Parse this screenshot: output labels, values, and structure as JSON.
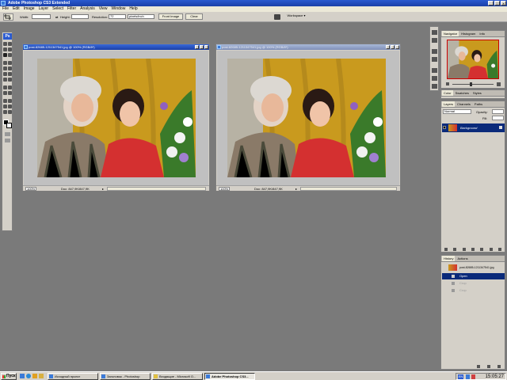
{
  "window": {
    "title": "Adobe Photoshop CS3 Extended"
  },
  "menu": [
    "File",
    "Edit",
    "Image",
    "Layer",
    "Select",
    "Filter",
    "Analysis",
    "View",
    "Window",
    "Help"
  ],
  "options_bar": {
    "width_label": "Width:",
    "height_label": "Height:",
    "resolution_label": "Resolution:",
    "resolution_value": "72",
    "resolution_unit": "pixels/inch",
    "front_image_label": "Front Image",
    "clear_label": "Clear",
    "workspace_label": "Workspace"
  },
  "toolbox": {
    "logo": "Ps"
  },
  "documents": [
    {
      "title": "post-82685-1211347541.jpg @ 100% (RGB/8*)",
      "zoom": "100%",
      "doc_info": "Doc: 847,9K/847,9K",
      "active": true
    },
    {
      "title": "post-82685-1211347541.jpg @ 100% (RGB/8*)",
      "zoom": "100%",
      "doc_info": "Doc: 847,9K/847,9K",
      "active": false
    }
  ],
  "panels": {
    "navigator_tabs": [
      "Navigator",
      "Histogram",
      "Info"
    ],
    "color_tabs": [
      "Color",
      "Swatches",
      "Styles"
    ],
    "layers_tabs": [
      "Layers",
      "Channels",
      "Paths"
    ],
    "layers_mode": "Normal",
    "layers_opacity_label": "Opacity:",
    "layers_fill_label": "Fill:",
    "layer_name": "Background",
    "history_tabs": [
      "History",
      "Actions"
    ],
    "history_snapshot": "post-82685-1211347541.jpg",
    "history_items": [
      "Open",
      "Crop",
      "Crop"
    ]
  },
  "taskbar": {
    "start_label": "Пуск",
    "tasks": [
      {
        "label": "Исходный проект",
        "active": false
      },
      {
        "label": "Заголовок - Photoshop",
        "active": false
      },
      {
        "label": "Входящие - Microsoft O...",
        "active": false
      },
      {
        "label": "Adobe Photoshop CS3...",
        "active": true
      }
    ],
    "lang": "EN",
    "clock": "15:05:27"
  },
  "colors": {
    "title_blue": "#1a3fa8",
    "photo_yellow": "#c99a1e",
    "shirt_red": "#d43030",
    "panel_grey": "#d4d0c8",
    "workspace_grey": "#7a7a7a"
  }
}
